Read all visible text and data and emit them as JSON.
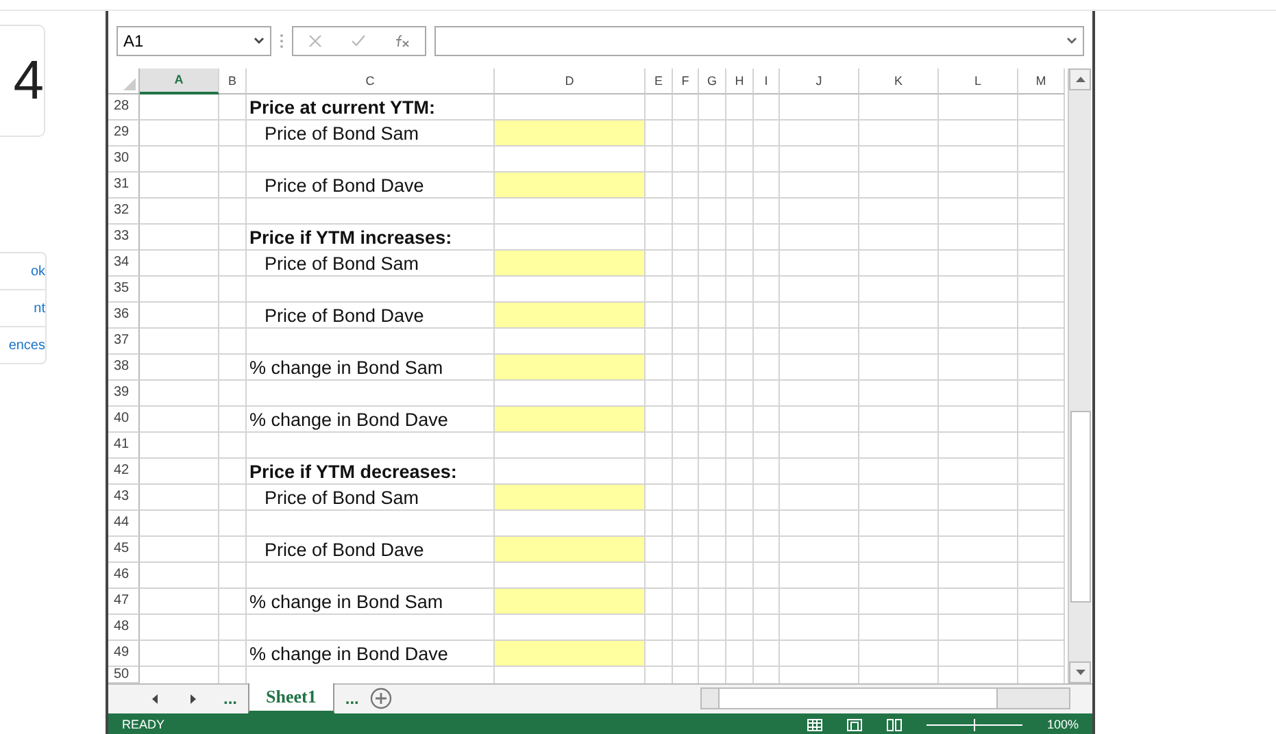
{
  "side_panel": {
    "number": "4",
    "links": [
      "ok",
      "nt",
      "ences"
    ]
  },
  "formula_bar": {
    "name_box": "A1"
  },
  "columns": [
    {
      "label": "A",
      "selected": true
    },
    {
      "label": "B",
      "selected": false
    },
    {
      "label": "C",
      "selected": false
    },
    {
      "label": "D",
      "selected": false
    },
    {
      "label": "E",
      "selected": false
    },
    {
      "label": "F",
      "selected": false
    },
    {
      "label": "G",
      "selected": false
    },
    {
      "label": "H",
      "selected": false
    },
    {
      "label": "I",
      "selected": false
    },
    {
      "label": "J",
      "selected": false
    },
    {
      "label": "K",
      "selected": false
    },
    {
      "label": "L",
      "selected": false
    },
    {
      "label": "M",
      "selected": false
    }
  ],
  "rows": [
    {
      "number": "28",
      "kind": "heading",
      "text": "Price at current YTM:",
      "highlight": false
    },
    {
      "number": "29",
      "kind": "item",
      "text": "Price of Bond Sam",
      "highlight": true
    },
    {
      "number": "30",
      "kind": "blank",
      "highlight": false
    },
    {
      "number": "31",
      "kind": "item",
      "text": "Price of Bond Dave",
      "highlight": true
    },
    {
      "number": "32",
      "kind": "blank",
      "highlight": false
    },
    {
      "number": "33",
      "kind": "heading",
      "text": "Price if YTM increases:",
      "highlight": false
    },
    {
      "number": "34",
      "kind": "item",
      "text": "Price of Bond Sam",
      "highlight": true
    },
    {
      "number": "35",
      "kind": "blank",
      "highlight": false
    },
    {
      "number": "36",
      "kind": "item",
      "text": "Price of Bond Dave",
      "highlight": true
    },
    {
      "number": "37",
      "kind": "blank",
      "highlight": false
    },
    {
      "number": "38",
      "kind": "label",
      "text": "% change in Bond Sam",
      "highlight": true
    },
    {
      "number": "39",
      "kind": "blank",
      "highlight": false
    },
    {
      "number": "40",
      "kind": "label",
      "text": "% change in Bond Dave",
      "highlight": true
    },
    {
      "number": "41",
      "kind": "blank",
      "highlight": false
    },
    {
      "number": "42",
      "kind": "heading",
      "text": "Price if YTM decreases:",
      "highlight": false
    },
    {
      "number": "43",
      "kind": "item",
      "text": "Price of Bond Sam",
      "highlight": true
    },
    {
      "number": "44",
      "kind": "blank",
      "highlight": false
    },
    {
      "number": "45",
      "kind": "item",
      "text": "Price of Bond Dave",
      "highlight": true
    },
    {
      "number": "46",
      "kind": "blank",
      "highlight": false
    },
    {
      "number": "47",
      "kind": "label",
      "text": "% change in Bond Sam",
      "highlight": true
    },
    {
      "number": "48",
      "kind": "blank",
      "highlight": false
    },
    {
      "number": "49",
      "kind": "label",
      "text": "% change in Bond Dave",
      "highlight": true
    },
    {
      "number": "50",
      "kind": "blank",
      "highlight": false
    }
  ],
  "sheet_tabs": {
    "before": "...",
    "tabs": [
      {
        "label": "Sheet1",
        "selected": true
      }
    ],
    "after": "..."
  },
  "status_bar": {
    "status": "READY",
    "zoom": "100%"
  }
}
